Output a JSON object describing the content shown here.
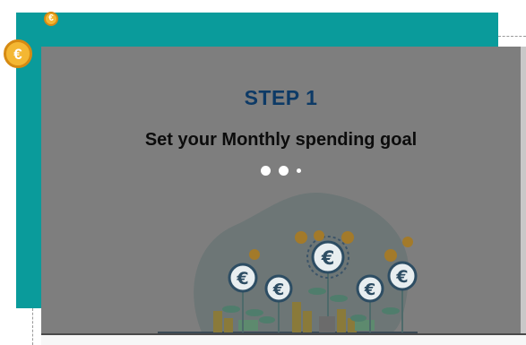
{
  "onboarding": {
    "step_label": "STEP 1",
    "heading": "Set your Monthly spending goal",
    "pagination": {
      "total": 3,
      "current": 1
    }
  },
  "icons": {
    "coin": "euro-coin-icon",
    "currency_symbol": "€",
    "illustration": "euro-money-tree-illustration"
  },
  "colors": {
    "frame": "#0a9b9b",
    "overlay": "#7e7e7e",
    "step_label": "#0d3a66",
    "coin": "#f4b733"
  }
}
